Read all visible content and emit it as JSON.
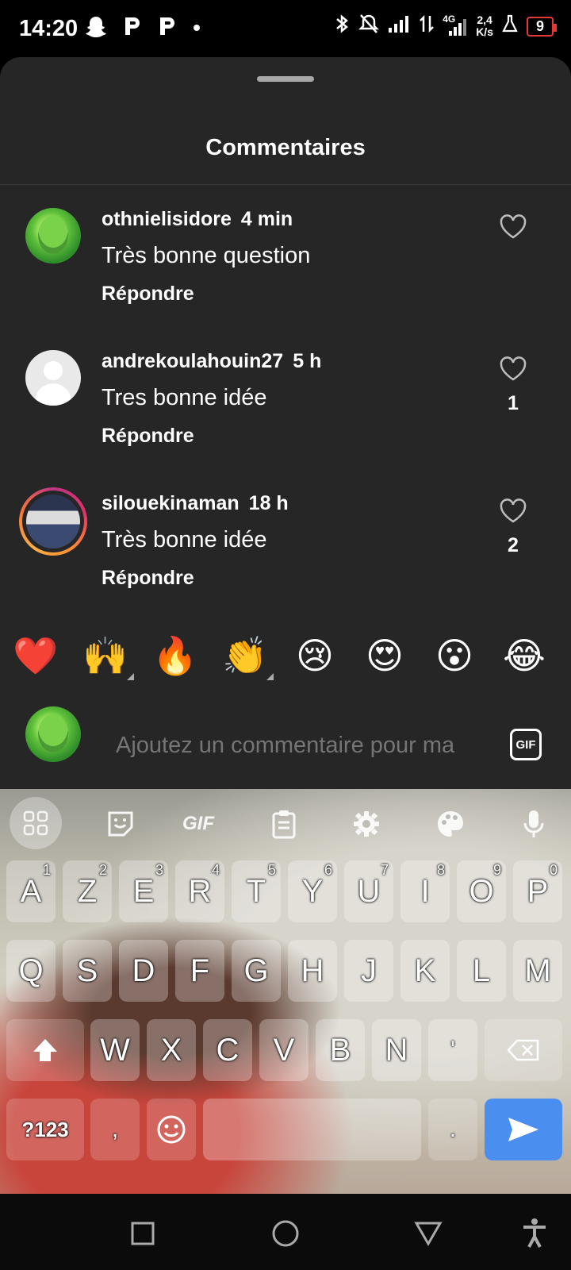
{
  "status_bar": {
    "time": "14:20",
    "left_icons": [
      "snapchat-icon",
      "p-icon",
      "p-icon",
      "dot-icon"
    ],
    "network_type": "4G",
    "speed_value": "2,4",
    "speed_unit": "K/s",
    "battery": "9",
    "battery_color": "#e53935"
  },
  "sheet": {
    "title": "Commentaires"
  },
  "comments": [
    {
      "username": "othnielisidore",
      "time": "4 min",
      "text": "Très bonne question",
      "reply": "Répondre",
      "likes": ""
    },
    {
      "username": "andrekoulahouin27",
      "time": "5 h",
      "text": "Tres bonne idée",
      "reply": "Répondre",
      "likes": "1"
    },
    {
      "username": "silouekinaman",
      "time": "18 h",
      "text": "Très bonne idée",
      "reply": "Répondre",
      "likes": "2"
    }
  ],
  "emoji_reactions": [
    "❤️",
    "🙌",
    "🔥",
    "👏",
    "😢",
    "😍",
    "😮",
    "😂"
  ],
  "compose": {
    "placeholder": "Ajoutez un commentaire pour ma",
    "gif_label": "GIF"
  },
  "keyboard": {
    "toolbar_icons": [
      "apps-grid-icon",
      "sticker-icon",
      "gif-icon",
      "clipboard-icon",
      "settings-icon",
      "palette-icon",
      "mic-icon"
    ],
    "toolbar_gif_label": "GIF",
    "row1": [
      {
        "key": "A",
        "hint": "1"
      },
      {
        "key": "Z",
        "hint": "2"
      },
      {
        "key": "E",
        "hint": "3"
      },
      {
        "key": "R",
        "hint": "4"
      },
      {
        "key": "T",
        "hint": "5"
      },
      {
        "key": "Y",
        "hint": "6"
      },
      {
        "key": "U",
        "hint": "7"
      },
      {
        "key": "I",
        "hint": "8"
      },
      {
        "key": "O",
        "hint": "9"
      },
      {
        "key": "P",
        "hint": "0"
      }
    ],
    "row2": [
      "Q",
      "S",
      "D",
      "F",
      "G",
      "H",
      "J",
      "K",
      "L",
      "M"
    ],
    "row3": [
      "W",
      "X",
      "C",
      "V",
      "B",
      "N",
      "'"
    ],
    "numbers_key": "?123",
    "comma_key": ",",
    "period_key": ".",
    "send_color": "#4a8ff0"
  },
  "nav_bar": {
    "buttons": [
      "recent-apps-icon",
      "home-icon",
      "back-icon",
      "accessibility-icon"
    ]
  },
  "colors": {
    "sheet_bg": "#262626",
    "page_bg": "#000000"
  }
}
